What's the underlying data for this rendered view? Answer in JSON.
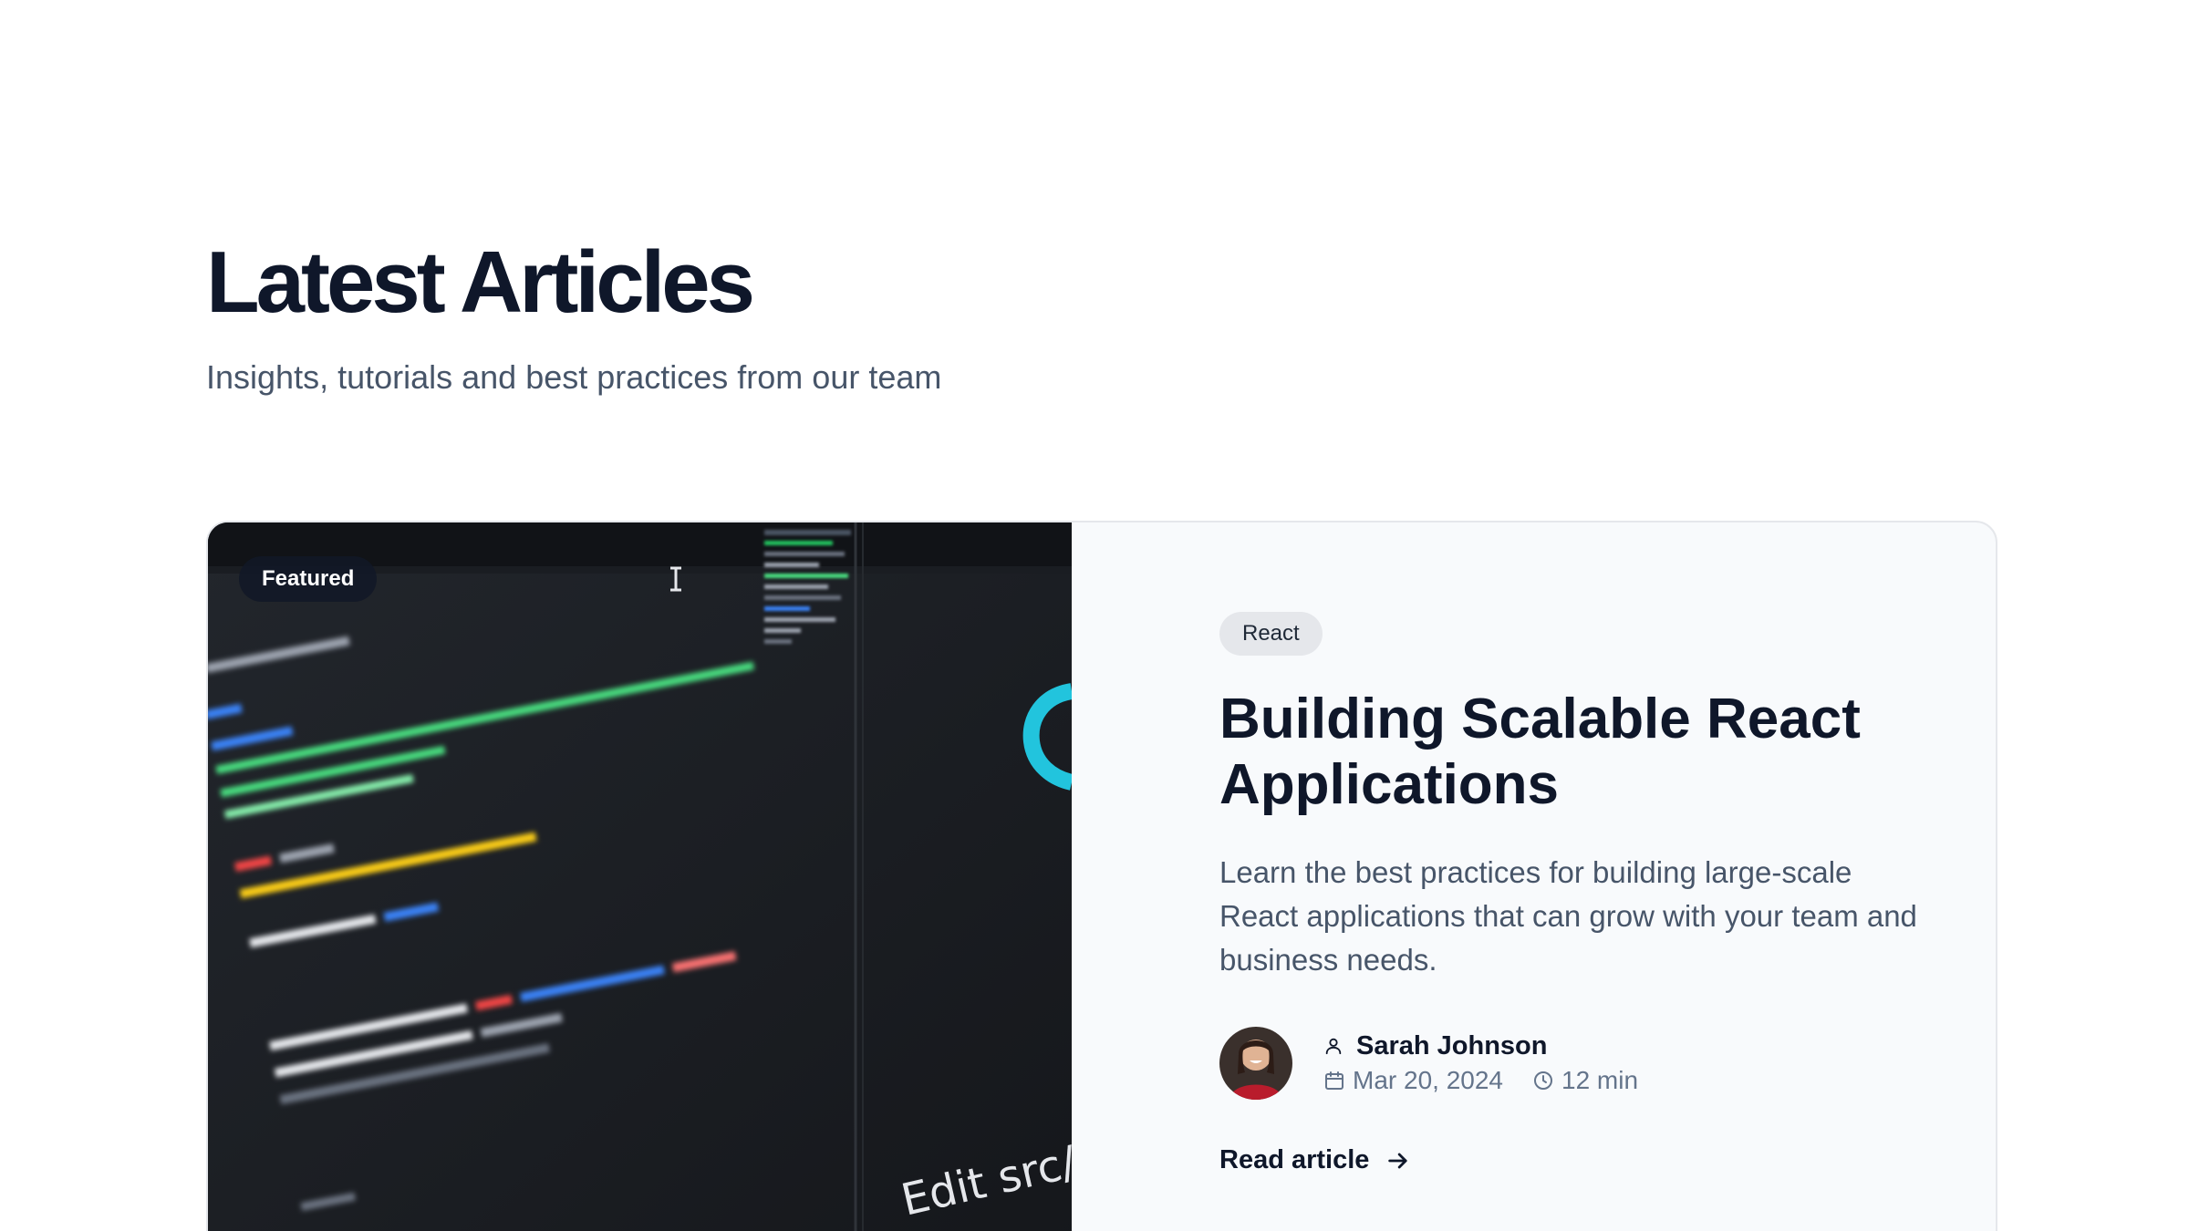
{
  "header": {
    "title": "Latest Articles",
    "subtitle": "Insights, tutorials and best practices from our team"
  },
  "featured_article": {
    "badge": "Featured",
    "image_caption": "Edit src/",
    "category": "React",
    "title": "Building Scalable React Applications",
    "excerpt": "Learn the best practices for building large-scale React applications that can grow with your team and business needs.",
    "author": "Sarah Johnson",
    "date": "Mar 20, 2024",
    "read_time": "12 min",
    "cta": "Read article",
    "icons": {
      "author": "user-icon",
      "date": "calendar-icon",
      "read_time": "clock-icon",
      "cta": "arrow-right-icon"
    }
  },
  "colors": {
    "text_primary": "#0f172a",
    "text_secondary": "#475569",
    "card_background": "#f8fafc",
    "tag_background": "#e5e7eb",
    "code_green": "#4ade80",
    "code_blue": "#3b82f6",
    "accent_cyan": "#22c4dd"
  }
}
